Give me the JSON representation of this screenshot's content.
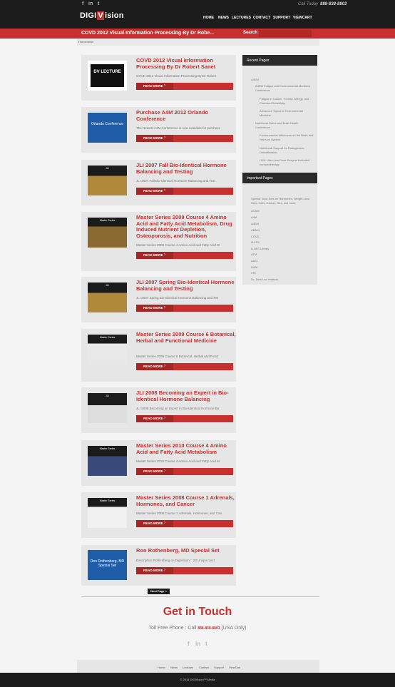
{
  "header": {
    "call_label": "Call Today",
    "phone": "888-838-8803",
    "logo_part1": "DIGI",
    "logo_part2": "V",
    "logo_part3": "ision",
    "nav": [
      "HOME",
      "NEWS",
      "LECTURES",
      "CONTACT",
      "SUPPORT",
      "VIEWCART"
    ],
    "page_title": "COVD 2012 Visual Information Processing By Dr Robe...",
    "search_label": "Search",
    "social": [
      "f",
      "in",
      "t"
    ]
  },
  "breadcrumb": "Home/news",
  "posts": [
    {
      "title": "COVD 2012 Visual Information Processing By Dr Robert Sanet",
      "excerpt": "COVD 2012 Visual Information Processing By Dr Robert",
      "thumb": "DV LECTURE",
      "readmore": "READ MORE"
    },
    {
      "title": "Purchase A4M 2012 Orlando Conference",
      "excerpt": "The Newest A4M Conference is now available for purchase",
      "thumb": "Orlando Conference",
      "readmore": "READ MORE"
    },
    {
      "title": "JLI 2007 Fall Bio-Identical Hormone Balancing and Testing",
      "excerpt": "JLI 2007 Fall Bio-Identical Hormone Balancing and Test",
      "thumb": "JLI",
      "readmore": "READ MORE"
    },
    {
      "title": "Master Series 2009 Course 4 Amino Acid and Fatty Acid Metabolism, Drug Induced Nutrient Depletion, Osteoporosis, and Nutrition",
      "excerpt": "Master Series 2009 Course 4 Amino Acid and Fatty Acid M",
      "thumb": "Master Series",
      "readmore": "READ MORE"
    },
    {
      "title": "JLI 2007 Spring Bio-Identical Hormone Balancing and Testing",
      "excerpt": "JLI 2007 Spring Bio-Identical Hormone Balancing and Tes",
      "thumb": "JLI",
      "readmore": "READ MORE"
    },
    {
      "title": "Master Series 2009 Course 6 Botanical, Herbal and Functional Medicine",
      "excerpt": "Master Series 2009 Course 6 Botanical, Herbal and Funct",
      "thumb": "Master Series",
      "readmore": "READ MORE"
    },
    {
      "title": "JLI 2008 Becoming an Expert in Bio-Identical Hormone Balancing",
      "excerpt": "JLI 2008 Becoming an Expert in Bio-Identical Hormone Ba",
      "thumb": "JLI",
      "readmore": "READ MORE"
    },
    {
      "title": "Master Series 2010 Course 4 Amino Acid and Fatty Acid Metabolism",
      "excerpt": "Master Series 2010 Course 4 Amino Acid and Fatty Acid M",
      "thumb": "Master Series",
      "readmore": "READ MORE"
    },
    {
      "title": "Master Series 2008 Course 1 Adrenals, Hormones, and Cancer",
      "excerpt": "Master Series 2008 Course 1 Adrenals, Hormones, and Can",
      "thumb": "Master Series",
      "readmore": "READ MORE"
    },
    {
      "title": "Ron Rothenberg, MD Special Set",
      "excerpt": "Description Rothenberg on DigiVision :: 23 Unique Lect",
      "thumb": "Ron Rothenberg, MD Special Set",
      "readmore": "READ MORE"
    }
  ],
  "next_page": "Next Page »",
  "sidebar": {
    "recent_title": "Recent Pages",
    "recent": [
      "A4EM",
      "A4EM Fatigue and Environmental Medicine Conference",
      "Fatigue in Cancer, Toxicity, Allergy, and Chemical Sensitivity",
      "Advanced Topics in Environmental Medicine",
      "Nutritional Detox and Brain Health Conference",
      "Environmental Influences on the Brain and Nervous System",
      "Nutritional Support for Endogenous Detoxification",
      "LDA: Ultra Low Dose Enzyme Activated Immunotherapy"
    ],
    "important_title": "Important Pages",
    "important": [
      "Special Topic Sets on Hormones, Weight Loss, Stem Cells, Cancer, Sex, and more",
      "ACAM",
      "A4M",
      "A4EM",
      "AMMG",
      "COVD",
      "IACFS",
      "B-HRT Library",
      "ATM",
      "AACL",
      "DAN!",
      "IHS",
      "Dr. John Lee Institute"
    ]
  },
  "footer": {
    "heading": "Get in Touch",
    "phone_prefix": "Toll Free Phone : Call",
    "phone": "888-838-8803",
    "phone_suffix": "(USA Only)",
    "nav": [
      "Home",
      "News",
      "Lectures",
      "Contact",
      "Support",
      "ViewCart"
    ],
    "copyright": "© 2014 DIGIVision™ Media"
  },
  "colors": {
    "accent": "#c8302f",
    "dark": "#1c1c1c"
  }
}
